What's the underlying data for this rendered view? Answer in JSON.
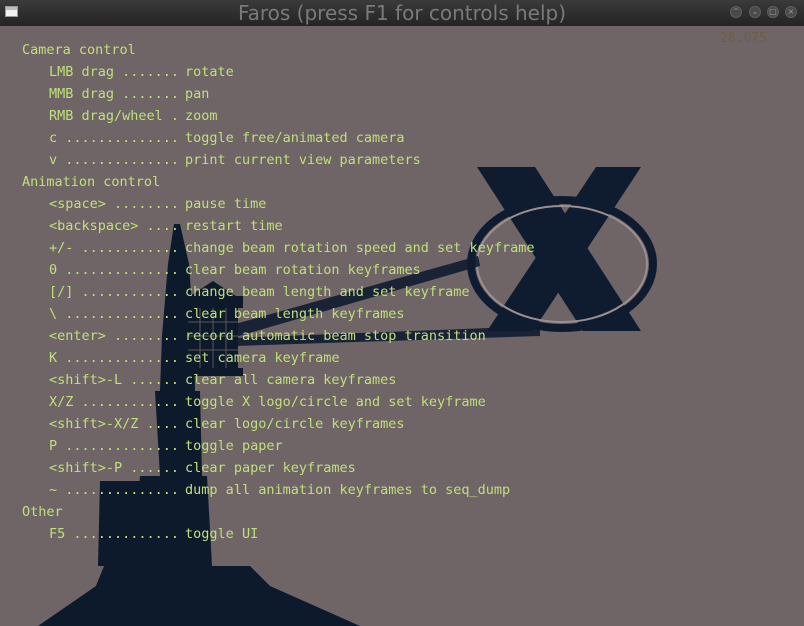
{
  "window": {
    "title": "Faros (press F1 for controls help)",
    "icon": "app-window-icon",
    "controls": [
      "collapse",
      "expand",
      "maximize",
      "close"
    ]
  },
  "overlay": {
    "fps": "28.075"
  },
  "colors": {
    "background": "#6f6466",
    "help_text": "#bfe07a",
    "silhouette": "#0d1a2b",
    "titlebar": "#2e2e2e"
  },
  "help": {
    "sections": [
      {
        "title": "Camera control",
        "items": [
          {
            "key": "LMB drag .......",
            "desc": "rotate"
          },
          {
            "key": "MMB drag .......",
            "desc": "pan"
          },
          {
            "key": "RMB drag/wheel .",
            "desc": "zoom"
          },
          {
            "key": "c ..............",
            "desc": "toggle free/animated camera"
          },
          {
            "key": "v ..............",
            "desc": "print current view parameters"
          }
        ]
      },
      {
        "title": "Animation control",
        "items": [
          {
            "key": "<space> ........",
            "desc": "pause time"
          },
          {
            "key": "<backspace> ....",
            "desc": "restart time"
          },
          {
            "key": "+/- ............",
            "desc": "change beam rotation speed and set keyframe"
          },
          {
            "key": "0 ..............",
            "desc": "clear beam rotation keyframes"
          },
          {
            "key": "[/] ............",
            "desc": "change beam length and set keyframe"
          },
          {
            "key": "\\ ..............",
            "desc": "clear beam length keyframes"
          },
          {
            "key": "<enter> ........",
            "desc": "record automatic beam stop transition"
          },
          {
            "key": "K ..............",
            "desc": "set camera keyframe"
          },
          {
            "key": "<shift>-L ......",
            "desc": "clear all camera keyframes"
          },
          {
            "key": "X/Z ............",
            "desc": "toggle X logo/circle and set keyframe"
          },
          {
            "key": "<shift>-X/Z ....",
            "desc": "clear logo/circle keyframes"
          },
          {
            "key": "P ..............",
            "desc": "toggle paper"
          },
          {
            "key": "<shift>-P ......",
            "desc": "clear paper keyframes"
          },
          {
            "key": "~ ..............",
            "desc": "dump all animation keyframes to seq_dump"
          }
        ]
      },
      {
        "title": "Other",
        "items": [
          {
            "key": "F5 .............",
            "desc": "toggle UI"
          }
        ]
      }
    ]
  }
}
